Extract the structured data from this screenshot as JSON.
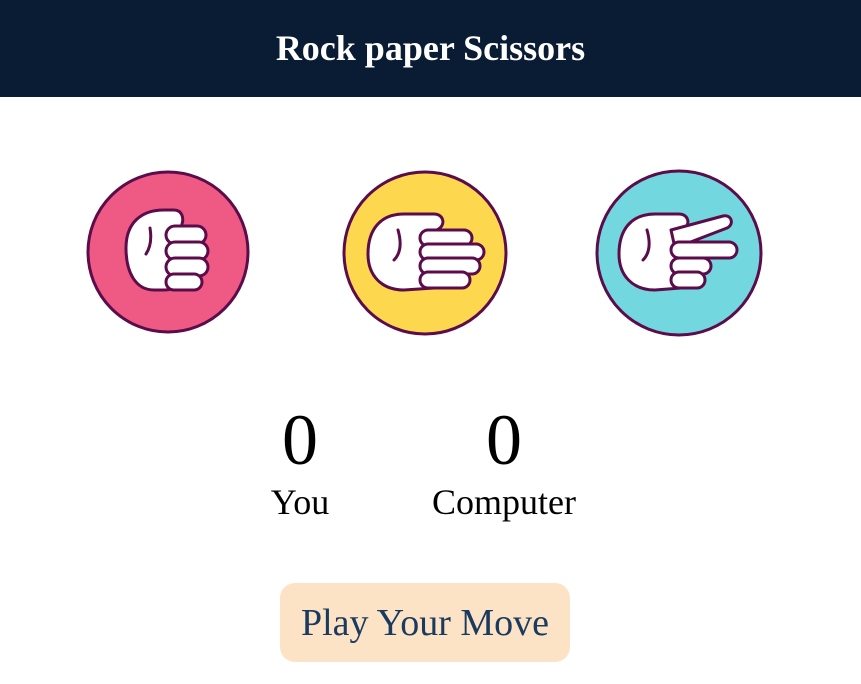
{
  "header": {
    "title": "Rock paper Scissors"
  },
  "choices": [
    {
      "id": "rock",
      "icon": "rock-hand-icon",
      "color": "#ef5a84"
    },
    {
      "id": "paper",
      "icon": "paper-hand-icon",
      "color": "#fdd84f"
    },
    {
      "id": "scissors",
      "icon": "scissors-hand-icon",
      "color": "#72d7df"
    }
  ],
  "outline_color": "#5c0c4a",
  "scores": {
    "user": {
      "value": "0",
      "label": "You"
    },
    "computer": {
      "value": "0",
      "label": "Computer"
    }
  },
  "message": {
    "text": "Play Your Move",
    "bg": "#fde3c5",
    "color": "#1a3a5f"
  }
}
